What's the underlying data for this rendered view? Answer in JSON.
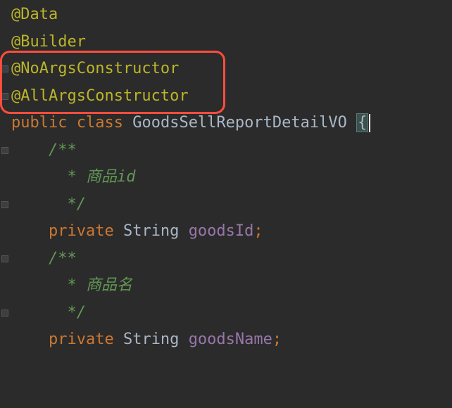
{
  "lines": {
    "l0": {
      "annotation": "@Data"
    },
    "l1": {
      "annotation": "@Builder"
    },
    "l2": {
      "annotation": "@NoArgsConstructor"
    },
    "l3": {
      "annotation": "@AllArgsConstructor"
    },
    "l4": {
      "kw_public": "public",
      "kw_class": "class",
      "classname": "GoodsSellReportDetailVO",
      "brace": "{"
    },
    "l5": {
      "comment": "/**"
    },
    "l6": {
      "comment_star": " * ",
      "comment_text": "商品id"
    },
    "l7": {
      "comment": " */"
    },
    "l8": {
      "kw_private": "private",
      "type": "String",
      "field": "goodsId",
      "semi": ";"
    },
    "l9": {
      "comment": "/**"
    },
    "l10": {
      "comment_star": " * ",
      "comment_text": "商品名"
    },
    "l11": {
      "comment": " */"
    },
    "l12": {
      "kw_private": "private",
      "type": "String",
      "field": "goodsName",
      "semi": ";"
    }
  },
  "indent1": "    ",
  "indent2": "     "
}
